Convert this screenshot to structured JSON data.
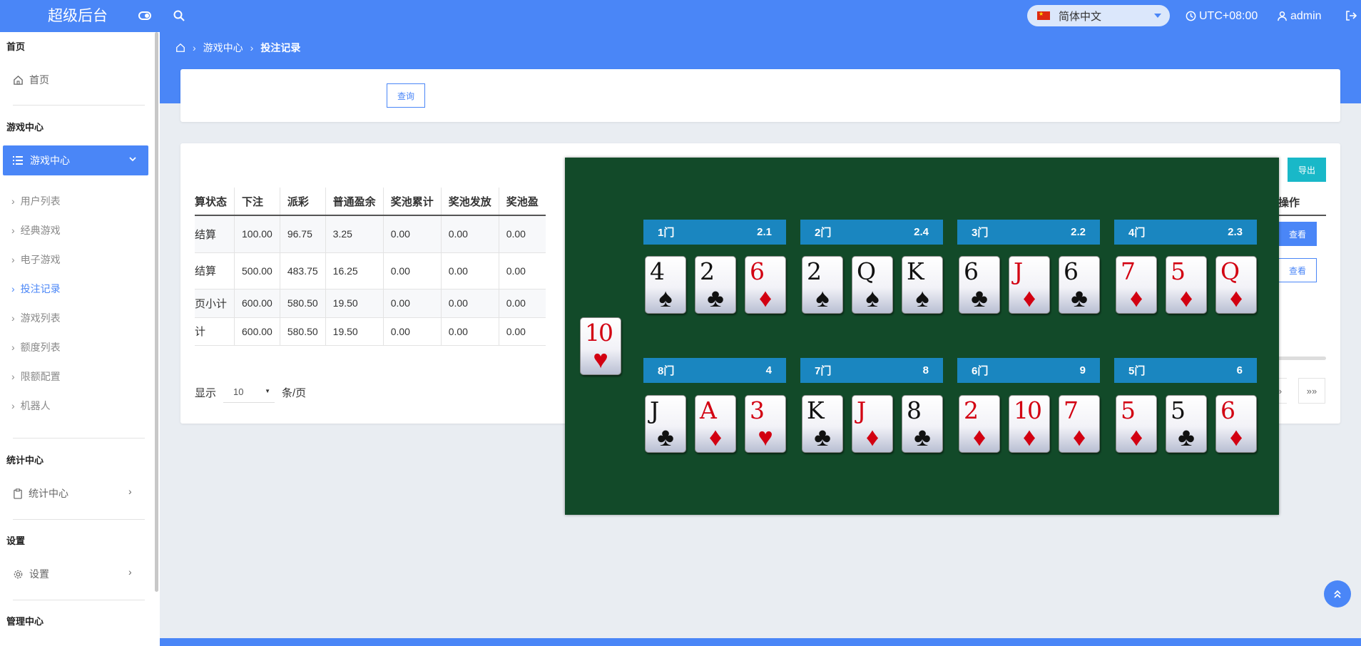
{
  "app": {
    "title": "超级后台"
  },
  "topbar": {
    "language": "简体中文",
    "timezone": "UTC+08:00",
    "user": "admin"
  },
  "sidebar": {
    "sections": [
      {
        "title": "首页",
        "items": [
          {
            "label": "首页",
            "icon": "home-icon"
          }
        ]
      },
      {
        "title": "游戏中心",
        "active": "游戏中心",
        "sub": [
          "用户列表",
          "经典游戏",
          "电子游戏",
          "投注记录",
          "游戏列表",
          "额度列表",
          "限额配置",
          "机器人"
        ],
        "current": "投注记录"
      },
      {
        "title": "统计中心",
        "items": [
          {
            "label": "统计中心",
            "icon": "clipboard-icon"
          }
        ]
      },
      {
        "title": "设置",
        "items": [
          {
            "label": "设置",
            "icon": "gear-icon"
          }
        ]
      },
      {
        "title": "管理中心"
      }
    ]
  },
  "breadcrumb": {
    "l1": "游戏中心",
    "l2": "投注记录"
  },
  "search": {
    "query_label": "查询"
  },
  "table": {
    "export_label": "导出",
    "columns": [
      "算状态",
      "下注",
      "派彩",
      "普通盈余",
      "奖池累计",
      "奖池发放",
      "奖池盈"
    ],
    "op_column": "操作",
    "rows": [
      [
        "结算",
        "100.00",
        "96.75",
        "3.25",
        "0.00",
        "0.00",
        "0.00"
      ],
      [
        "结算",
        "500.00",
        "483.75",
        "16.25",
        "0.00",
        "0.00",
        "0.00"
      ],
      [
        "页小计",
        "600.00",
        "580.50",
        "19.50",
        "0.00",
        "0.00",
        "0.00"
      ],
      [
        "计",
        "600.00",
        "580.50",
        "19.50",
        "0.00",
        "0.00",
        "0.00"
      ]
    ],
    "view_label": "查看",
    "pager": {
      "show": "显示",
      "per_page": "10",
      "unit": "条/页",
      "next": "»",
      "last": "»»"
    }
  },
  "game": {
    "banker_card": {
      "rank": "10",
      "suit": "♥"
    },
    "doors": [
      {
        "name": "1门",
        "odds": "2.1",
        "cards": [
          [
            "4",
            "♠"
          ],
          [
            "2",
            "♣"
          ],
          [
            "6",
            "♦"
          ]
        ]
      },
      {
        "name": "2门",
        "odds": "2.4",
        "cards": [
          [
            "2",
            "♠"
          ],
          [
            "Q",
            "♠"
          ],
          [
            "K",
            "♠"
          ]
        ]
      },
      {
        "name": "3门",
        "odds": "2.2",
        "cards": [
          [
            "6",
            "♣"
          ],
          [
            "J",
            "♦"
          ],
          [
            "6",
            "♣"
          ]
        ]
      },
      {
        "name": "4门",
        "odds": "2.3",
        "cards": [
          [
            "7",
            "♦"
          ],
          [
            "5",
            "♦"
          ],
          [
            "Q",
            "♦"
          ]
        ]
      },
      {
        "name": "8门",
        "odds": "4",
        "cards": [
          [
            "J",
            "♣"
          ],
          [
            "A",
            "♦"
          ],
          [
            "3",
            "♥"
          ]
        ]
      },
      {
        "name": "7门",
        "odds": "8",
        "cards": [
          [
            "K",
            "♣"
          ],
          [
            "J",
            "♦"
          ],
          [
            "8",
            "♣"
          ]
        ]
      },
      {
        "name": "6门",
        "odds": "9",
        "cards": [
          [
            "2",
            "♦"
          ],
          [
            "10",
            "♦"
          ],
          [
            "7",
            "♦"
          ]
        ]
      },
      {
        "name": "5门",
        "odds": "6",
        "cards": [
          [
            "5",
            "♦"
          ],
          [
            "5",
            "♣"
          ],
          [
            "6",
            "♦"
          ]
        ]
      }
    ]
  },
  "colors": {
    "primary": "#4a86f7",
    "felt": "#124a29",
    "door_header": "#1a86c0",
    "export": "#19b8c8",
    "red_suit": "#d20011"
  }
}
